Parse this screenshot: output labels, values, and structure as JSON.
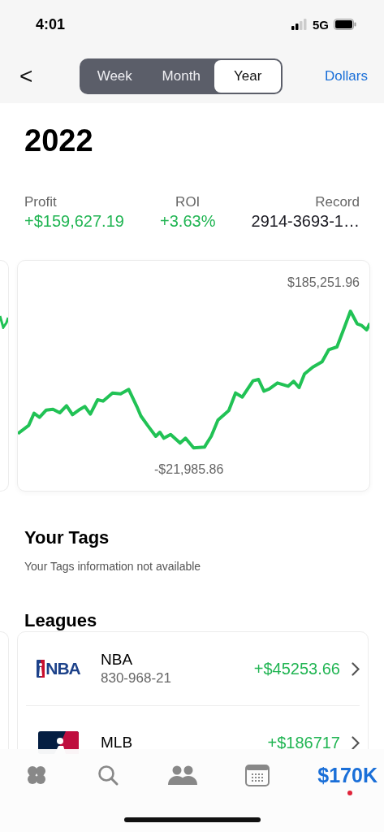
{
  "status_bar": {
    "time": "4:01",
    "network": "5G"
  },
  "nav": {
    "back": "<",
    "segments": [
      {
        "label": "Week",
        "selected": false
      },
      {
        "label": "Month",
        "selected": false
      },
      {
        "label": "Year",
        "selected": true
      }
    ],
    "action": "Dollars"
  },
  "title": "2022",
  "stats": [
    {
      "label": "Profit",
      "value": "+$159,627.19",
      "kind": "gain"
    },
    {
      "label": "ROI",
      "value": "+3.63%",
      "kind": "gain"
    },
    {
      "label": "Record",
      "value": "2914-3693-1…",
      "kind": "plain"
    }
  ],
  "chart": {
    "max_label": "$185,251.96",
    "min_label": "-$21,985.86"
  },
  "tags": {
    "heading": "Your Tags",
    "message": "Your Tags information not available"
  },
  "leagues": {
    "heading": "Leagues",
    "items": [
      {
        "name": "NBA",
        "kind": "nba",
        "logo_text": "NBA",
        "record": "830-968-21",
        "amount": "+$45253.66"
      },
      {
        "name": "MLB",
        "kind": "mlb",
        "amount": "+$186717"
      }
    ]
  },
  "tab_bar": [
    {
      "kind": "clover",
      "selected": false
    },
    {
      "kind": "search",
      "selected": false
    },
    {
      "kind": "people",
      "selected": false
    },
    {
      "kind": "calendar",
      "selected": false
    },
    {
      "kind": "balance",
      "label": "$170K",
      "selected": true,
      "badge": true
    }
  ]
}
